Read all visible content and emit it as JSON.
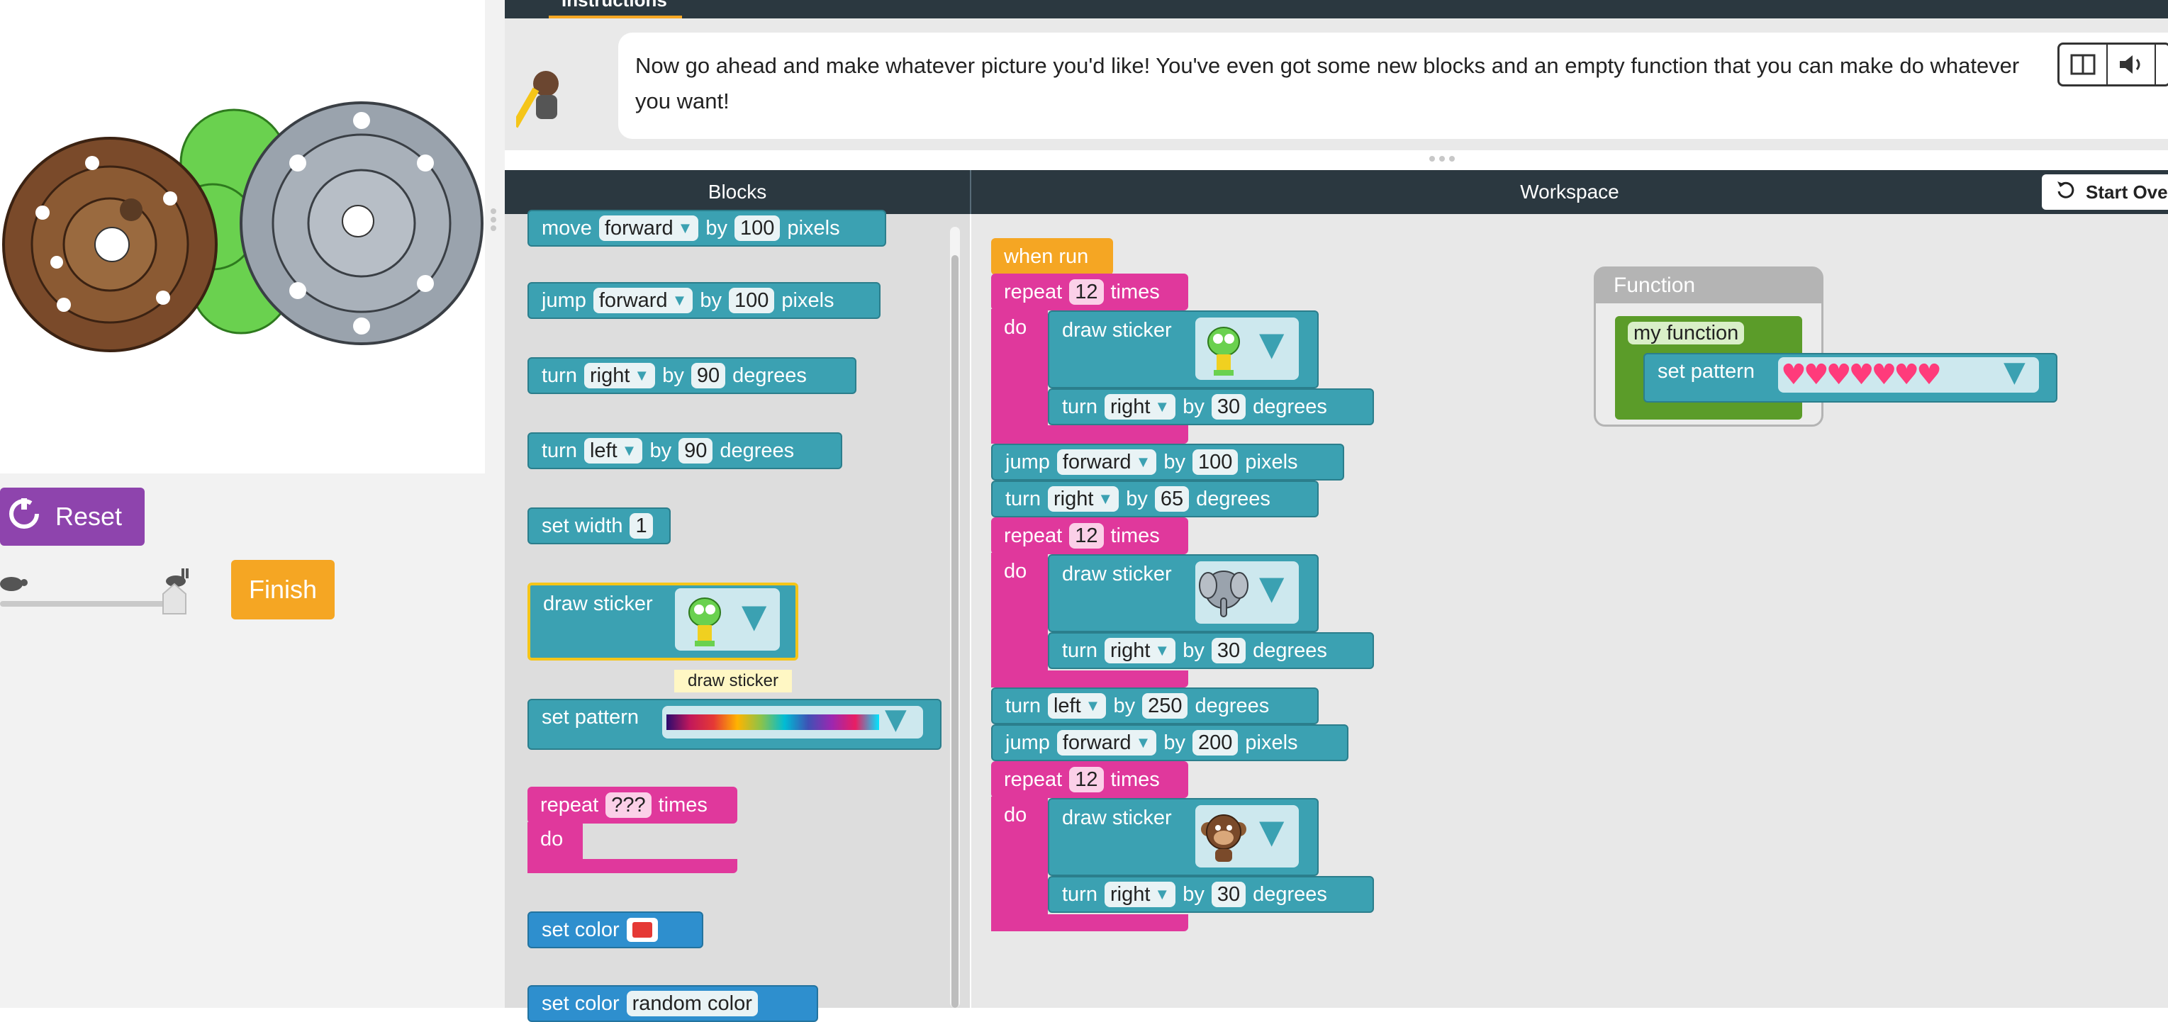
{
  "instructions": {
    "tab_label": "Instructions",
    "text": "Now go ahead and make whatever picture you'd like! You've even got some new blocks and an empty function that you can make do whatever you want!"
  },
  "controls": {
    "reset_label": "Reset",
    "finish_label": "Finish"
  },
  "headers": {
    "blocks": "Blocks",
    "workspace": "Workspace",
    "start_over": "Start Over"
  },
  "toolbox": {
    "move": {
      "verb": "move",
      "dir": "forward",
      "by": "by",
      "amount": "100",
      "unit": "pixels"
    },
    "jump": {
      "verb": "jump",
      "dir": "forward",
      "by": "by",
      "amount": "100",
      "unit": "pixels"
    },
    "turn_right": {
      "verb": "turn",
      "dir": "right",
      "by": "by",
      "amount": "90",
      "unit": "degrees"
    },
    "turn_left": {
      "verb": "turn",
      "dir": "left",
      "by": "by",
      "amount": "90",
      "unit": "degrees"
    },
    "set_width": {
      "label": "set width",
      "value": "1"
    },
    "draw_sticker": {
      "label": "draw sticker",
      "tooltip": "draw sticker"
    },
    "set_pattern": {
      "label": "set pattern"
    },
    "repeat": {
      "label": "repeat",
      "count": "???",
      "times": "times",
      "do": "do"
    },
    "set_color": {
      "label": "set color"
    },
    "set_color_random": {
      "label": "set color",
      "value": "random color"
    }
  },
  "workspace": {
    "when_run": "when run",
    "repeat1": {
      "label": "repeat",
      "count": "12",
      "times": "times",
      "do": "do"
    },
    "sticker1": {
      "label": "draw sticker"
    },
    "turn1": {
      "verb": "turn",
      "dir": "right",
      "by": "by",
      "amount": "30",
      "unit": "degrees"
    },
    "jump1": {
      "verb": "jump",
      "dir": "forward",
      "by": "by",
      "amount": "100",
      "unit": "pixels"
    },
    "turn2": {
      "verb": "turn",
      "dir": "right",
      "by": "by",
      "amount": "65",
      "unit": "degrees"
    },
    "repeat2": {
      "label": "repeat",
      "count": "12",
      "times": "times",
      "do": "do"
    },
    "sticker2": {
      "label": "draw sticker"
    },
    "turn3": {
      "verb": "turn",
      "dir": "right",
      "by": "by",
      "amount": "30",
      "unit": "degrees"
    },
    "turn4": {
      "verb": "turn",
      "dir": "left",
      "by": "by",
      "amount": "250",
      "unit": "degrees"
    },
    "jump2": {
      "verb": "jump",
      "dir": "forward",
      "by": "by",
      "amount": "200",
      "unit": "pixels"
    },
    "repeat3": {
      "label": "repeat",
      "count": "12",
      "times": "times",
      "do": "do"
    },
    "sticker3": {
      "label": "draw sticker"
    },
    "turn5": {
      "verb": "turn",
      "dir": "right",
      "by": "by",
      "amount": "30",
      "unit": "degrees"
    }
  },
  "function": {
    "title": "Function",
    "name": "my function",
    "set_pattern": "set pattern"
  },
  "colors": {
    "motion_teal": "#3ba1b2",
    "loop_pink": "#e0389c",
    "event_gold": "#f5a623",
    "function_green": "#5b9c29",
    "reset_purple": "#8e44ad",
    "header_dark": "#2b3840",
    "set_color_red": "#e53935"
  },
  "speed_slider": {
    "value": 1.0
  }
}
